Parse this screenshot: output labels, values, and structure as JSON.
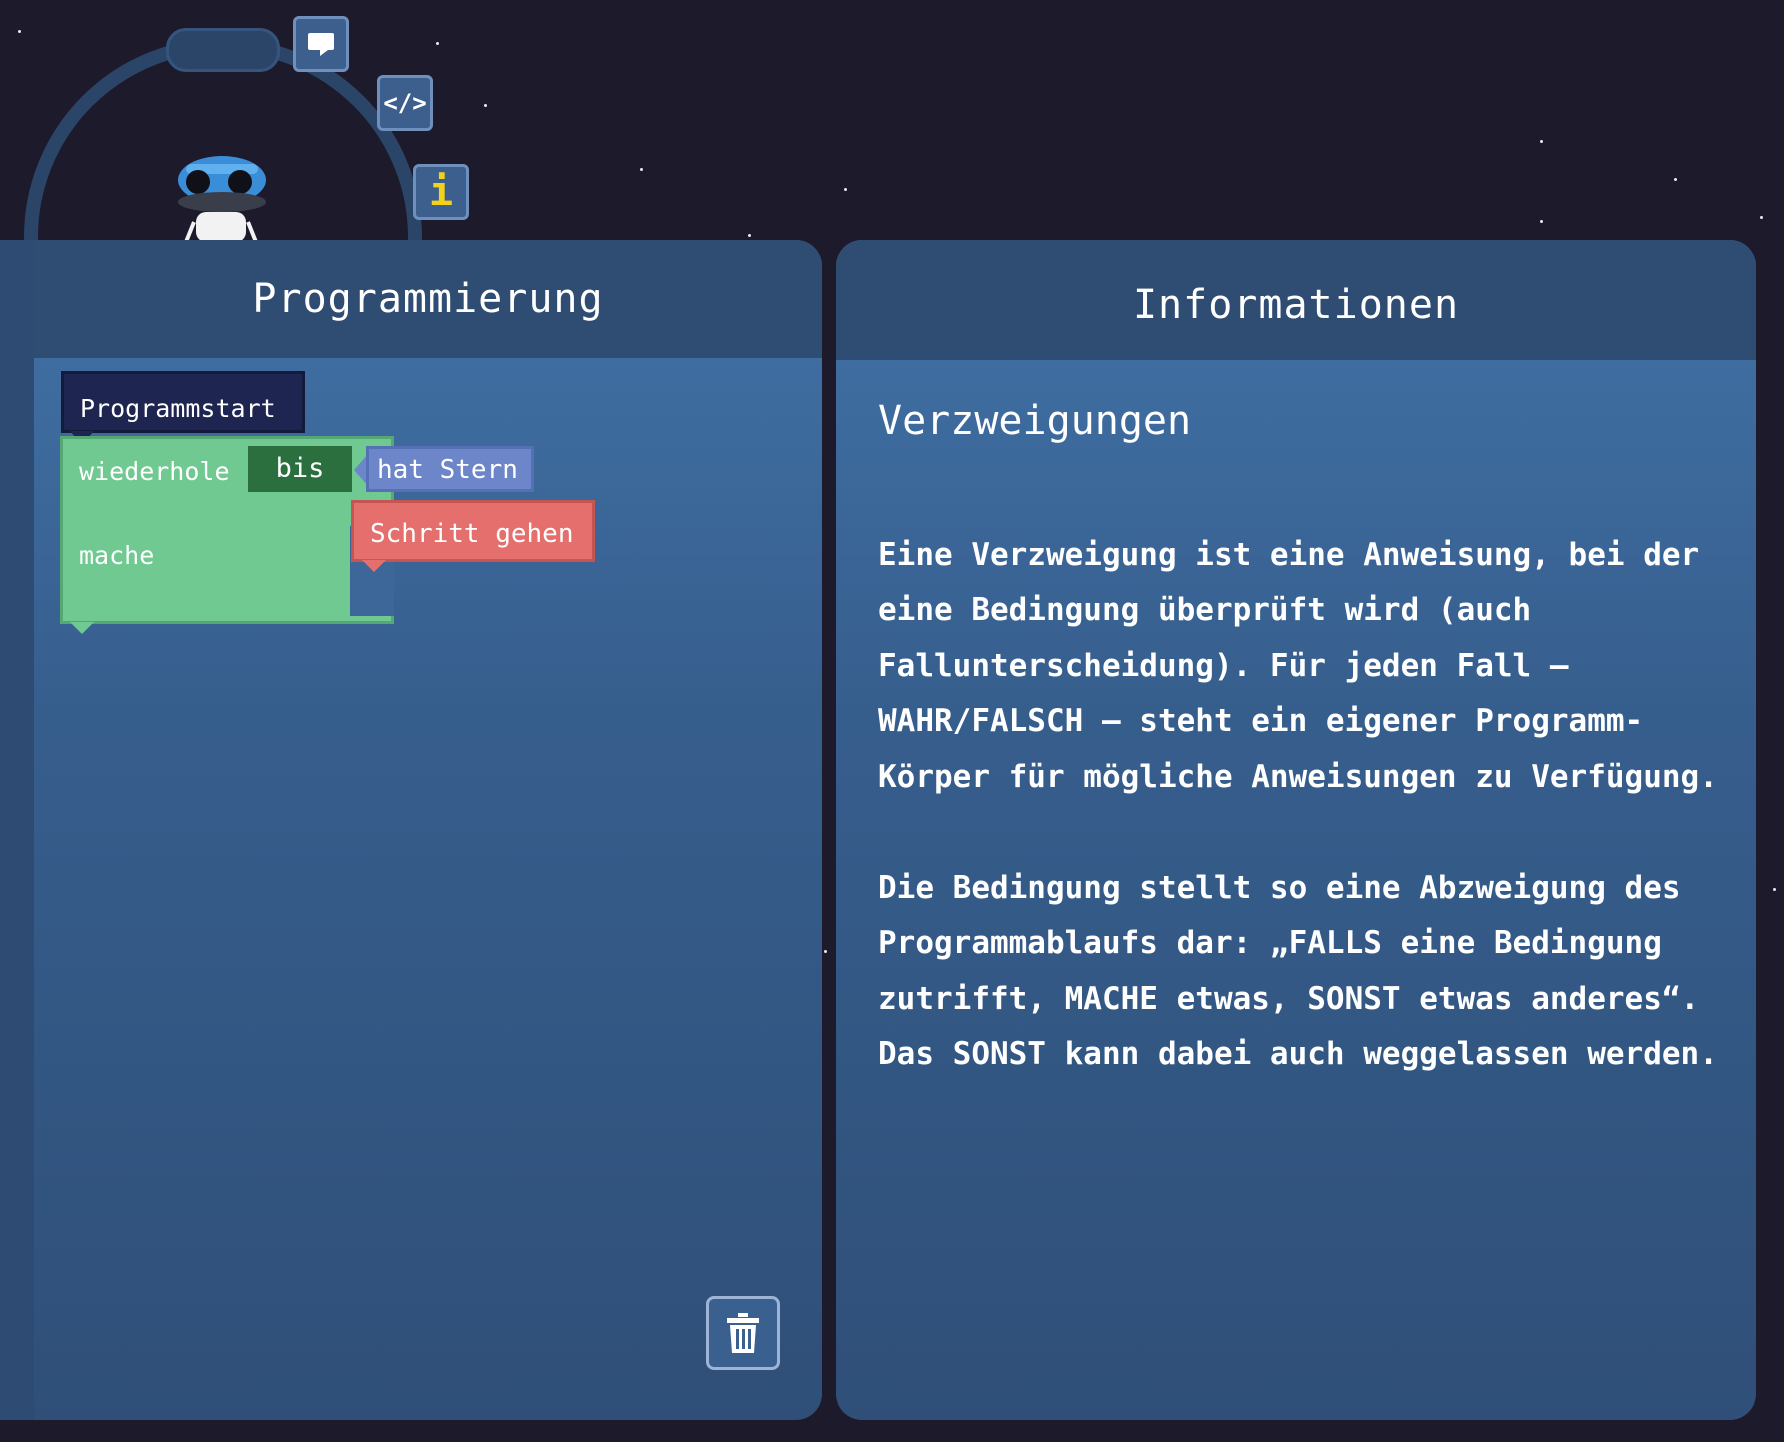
{
  "toolbar": {
    "chat_icon": "chat-bubble-icon",
    "code_label": "</>",
    "info_label": "i"
  },
  "programming_panel": {
    "title": "Programmierung",
    "blocks": {
      "start_label": "Programmstart",
      "repeat_label": "wiederhole",
      "until_label": "bis",
      "condition_label": "hat Stern",
      "do_label": "mache",
      "step_label": "Schritt gehen"
    },
    "trash_icon": "trash-icon"
  },
  "info_panel": {
    "title": "Informationen",
    "heading": "Verzweigungen",
    "paragraphs": [
      "Eine Verzweigung ist eine Anweisung, bei der eine Bedingung überprüft wird (auch Fallunterscheidung). Für jeden Fall – WAHR/FALSCH – steht ein eigener Programm-Körper für mögliche Anweisungen zu Verfügung.",
      "Die Bedingung stellt so eine Abzweigung des Programmablaufs dar: „FALLS eine Bedingung zutrifft, MACHE etwas, SONST etwas anderes“. Das SONST kann dabei auch weggelassen werden."
    ]
  },
  "colors": {
    "background": "#1d1a2b",
    "panel_header": "#2f4c73",
    "start_block": "#1e2550",
    "loop_block": "#70c991",
    "condition_block": "#6d86c9",
    "action_block": "#e46f6c"
  }
}
